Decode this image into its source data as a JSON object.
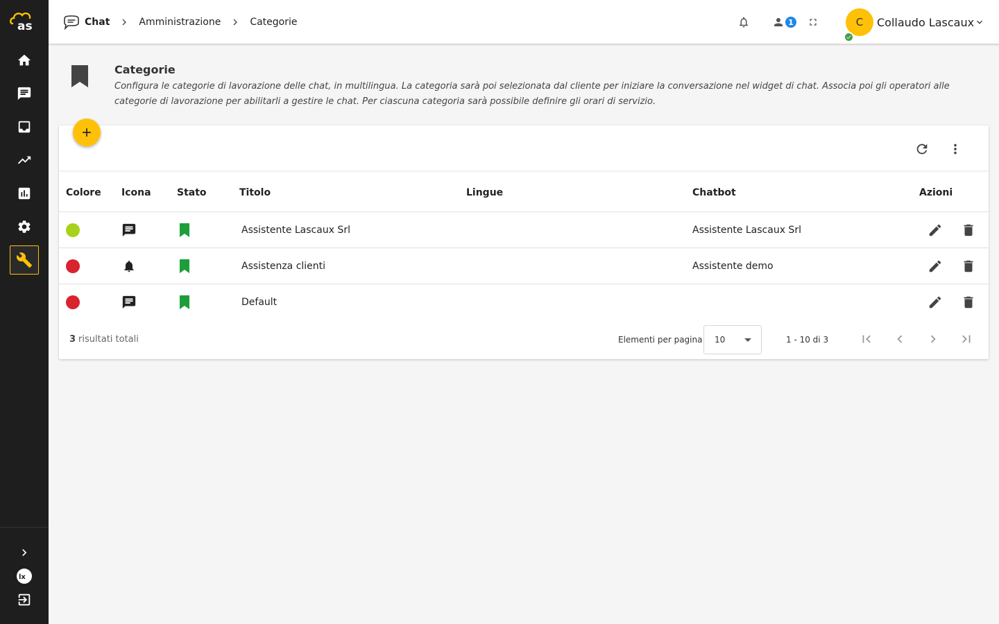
{
  "sidebar": {
    "logo_text": "as",
    "items": [
      {
        "icon": "home-icon"
      },
      {
        "icon": "chat-icon"
      },
      {
        "icon": "inbox-icon"
      },
      {
        "icon": "trending-icon"
      },
      {
        "icon": "chart-icon"
      },
      {
        "icon": "gear-icon"
      },
      {
        "icon": "wrench-icon",
        "active": true
      }
    ],
    "bottom": [
      "chevron-right-icon",
      "lx-logo-icon",
      "logout-icon"
    ],
    "accent": "#ffc107"
  },
  "header": {
    "breadcrumb": [
      "Chat",
      "Amministrazione",
      "Categorie"
    ],
    "notification_count": "1",
    "user": {
      "initial": "C",
      "name": "Collaudo Lascaux",
      "status": "online"
    }
  },
  "page": {
    "title": "Categorie",
    "description": "Configura le categorie di lavorazione delle chat, in multilingua. La categoria sarà poi selezionata dal cliente per iniziare la conversazione nel widget di chat. Associa poi gli operatori alle categorie di lavorazione per abilitarli a gestire le chat. Per ciascuna categoria sarà possibile definire gli orari di servizio."
  },
  "table": {
    "columns": {
      "colore": "Colore",
      "icona": "Icona",
      "stato": "Stato",
      "titolo": "Titolo",
      "lingue": "Lingue",
      "chatbot": "Chatbot",
      "azioni": "Azioni"
    },
    "rows": [
      {
        "color": "#a6d21c",
        "icon": "chat-icon",
        "status": "active",
        "title": "Assistente Lascaux Srl",
        "languages": "",
        "chatbot": "Assistente Lascaux Srl"
      },
      {
        "color": "#d9232e",
        "icon": "bell-icon",
        "status": "active",
        "title": "Assistenza clienti",
        "languages": "",
        "chatbot": "Assistente demo"
      },
      {
        "color": "#d9232e",
        "icon": "chat-icon",
        "status": "active",
        "title": "Default",
        "languages": "",
        "chatbot": ""
      }
    ]
  },
  "footer": {
    "total_count": "3",
    "total_label": "risultati totali",
    "per_page_label": "Elementi per pagina",
    "per_page_value": "10",
    "range": "1 - 10 di 3"
  },
  "colors": {
    "status_active": "#1e9e3a",
    "fab": "#ffc107",
    "badge": "#1e88e5"
  }
}
